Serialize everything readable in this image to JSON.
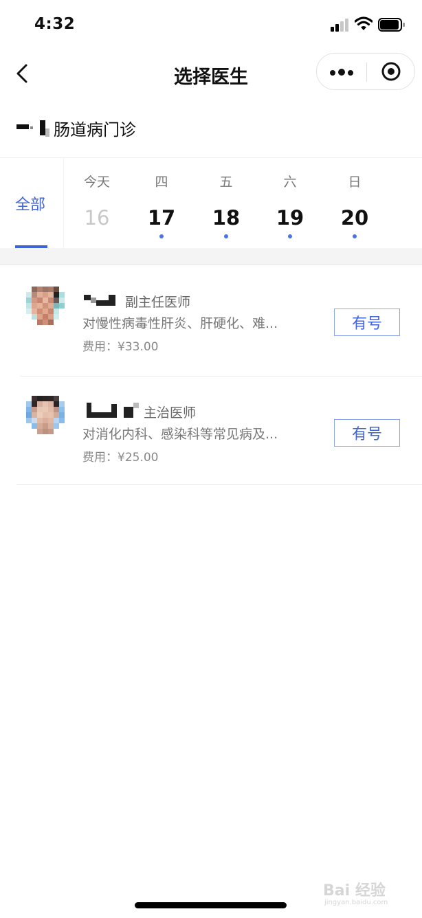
{
  "status": {
    "time": "4:32"
  },
  "nav": {
    "title": "选择医生",
    "back_icon": "chevron-left-icon",
    "more_icon": "more-dots-icon",
    "close_icon": "target-circle-icon"
  },
  "department": {
    "name": "肠道病门诊"
  },
  "dates": {
    "all_label": "全部",
    "days": [
      {
        "weekday": "今天",
        "day": "16",
        "available": false
      },
      {
        "weekday": "四",
        "day": "17",
        "available": true
      },
      {
        "weekday": "五",
        "day": "18",
        "available": true
      },
      {
        "weekday": "六",
        "day": "19",
        "available": true
      },
      {
        "weekday": "日",
        "day": "20",
        "available": true
      }
    ],
    "accent_color": "#3f63d8"
  },
  "doctors": [
    {
      "title": "副主任医师",
      "desc": "对慢性病毒性肝炎、肝硬化、难...",
      "fee": "费用：¥33.00",
      "button": "有号"
    },
    {
      "title": "主治医师",
      "desc": "对消化内科、感染科等常见病及...",
      "fee": "费用：¥25.00",
      "button": "有号"
    }
  ],
  "watermark": {
    "line1": "Bai 经验",
    "line2": "jingyan.baidu.com"
  }
}
